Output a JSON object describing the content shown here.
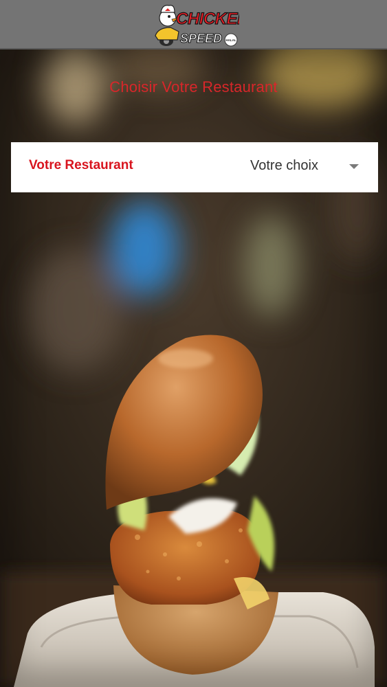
{
  "header": {
    "logo_line1": "CHICKEN",
    "logo_line2": "SPEED",
    "logo_badge": "HALAL",
    "logo_icon": "chef-scooter-mascot-icon"
  },
  "main": {
    "title": "Choisir Votre Restaurant",
    "picker": {
      "label": "Votre Restaurant",
      "selected_value": "Votre choix",
      "dropdown_icon": "chevron-down-icon"
    },
    "background_image": "burger-photo"
  },
  "colors": {
    "header_bg": "#747474",
    "accent_red": "#d8262a",
    "picker_bg": "#ffffff"
  }
}
